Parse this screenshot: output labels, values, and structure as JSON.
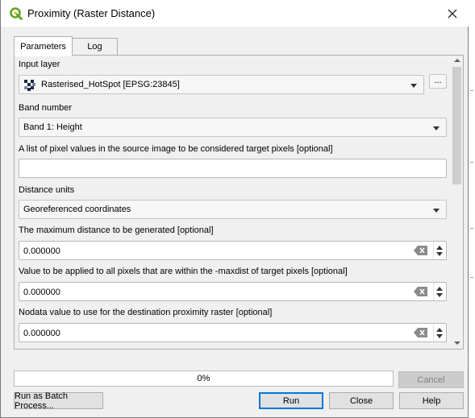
{
  "window": {
    "title": "Proximity (Raster Distance)",
    "app_icon": "qgis-icon",
    "close_icon": "close-icon"
  },
  "tabs": [
    {
      "label": "Parameters",
      "active": true
    },
    {
      "label": "Log",
      "active": false
    }
  ],
  "params": {
    "input_layer": {
      "label": "Input layer",
      "value": "Rasterised_HotSpot [EPSG:23845]",
      "browse_label": "...",
      "icon": "raster-layer-icon"
    },
    "band_number": {
      "label": "Band number",
      "value": "Band 1: Height"
    },
    "target_pixels": {
      "label": "A list of pixel values in the source image to be considered target pixels [optional]",
      "value": ""
    },
    "distance_units": {
      "label": "Distance units",
      "value": "Georeferenced coordinates"
    },
    "max_distance": {
      "label": "The maximum distance to be generated [optional]",
      "value": "0.000000"
    },
    "fixed_value": {
      "label": "Value to be applied to all pixels that are within the -maxdist of target pixels [optional]",
      "value": "0.000000"
    },
    "nodata": {
      "label": "Nodata value to use for the destination proximity raster [optional]",
      "value": "0.000000"
    }
  },
  "progress": {
    "text": "0%",
    "value": 0
  },
  "buttons": {
    "cancel": "Cancel",
    "batch": "Run as Batch Process...",
    "run": "Run",
    "close": "Close",
    "help": "Help"
  },
  "colors": {
    "accent": "#0078d7",
    "progress_fill": "#06b025",
    "qgis_green": "#5ea32a"
  }
}
